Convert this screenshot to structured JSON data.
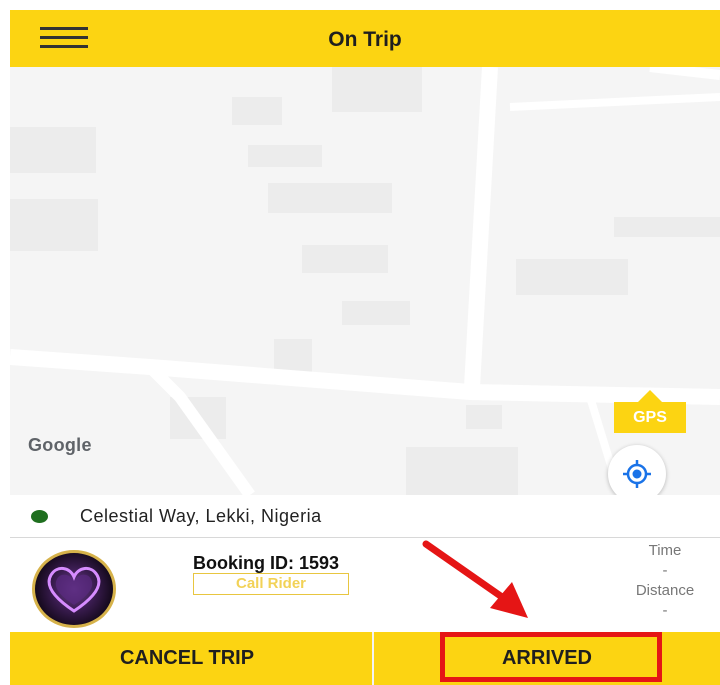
{
  "header": {
    "title": "On Trip",
    "menu_icon": "hamburger-menu-icon"
  },
  "map": {
    "provider_logo": "Google",
    "gps_label": "GPS",
    "locate_icon": "crosshair-locate-icon"
  },
  "location": {
    "address": "Celestial Way, Lekki, Nigeria",
    "status_color": "#1f6f1f"
  },
  "trip": {
    "booking_id": "Booking ID: 1593",
    "call_rider_label": "Call Rider",
    "time_label": "Time",
    "time_value": "-",
    "distance_label": "Distance",
    "distance_value": "-"
  },
  "actions": {
    "cancel_label": "CANCEL TRIP",
    "arrived_label": "ARRIVED"
  },
  "colors": {
    "accent": "#fcd412",
    "annotation": "#e51515"
  }
}
